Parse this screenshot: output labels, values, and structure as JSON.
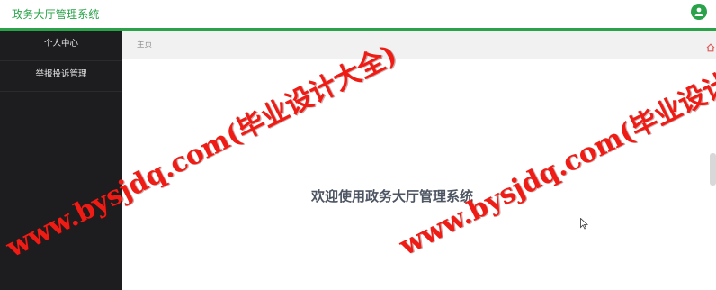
{
  "header": {
    "app_title": "政务大厅管理系统",
    "avatar_icon": "user-avatar-icon"
  },
  "sidebar": {
    "items": [
      {
        "label": "个人中心"
      },
      {
        "label": "举报投诉管理"
      }
    ]
  },
  "breadcrumb": {
    "current": "主页",
    "home_icon": "home-icon"
  },
  "main": {
    "welcome_text": "欢迎使用政务大厅管理系统"
  },
  "watermark": {
    "text_left": "www.bysjdq.com(毕业设计大全)",
    "text_right": "www.bysjdq.com(毕业设计大"
  },
  "colors": {
    "accent": "#2aa24a",
    "sidebar_bg": "#1d1d1f",
    "watermark": "#ee1c14",
    "welcome_text": "#4d5462"
  }
}
